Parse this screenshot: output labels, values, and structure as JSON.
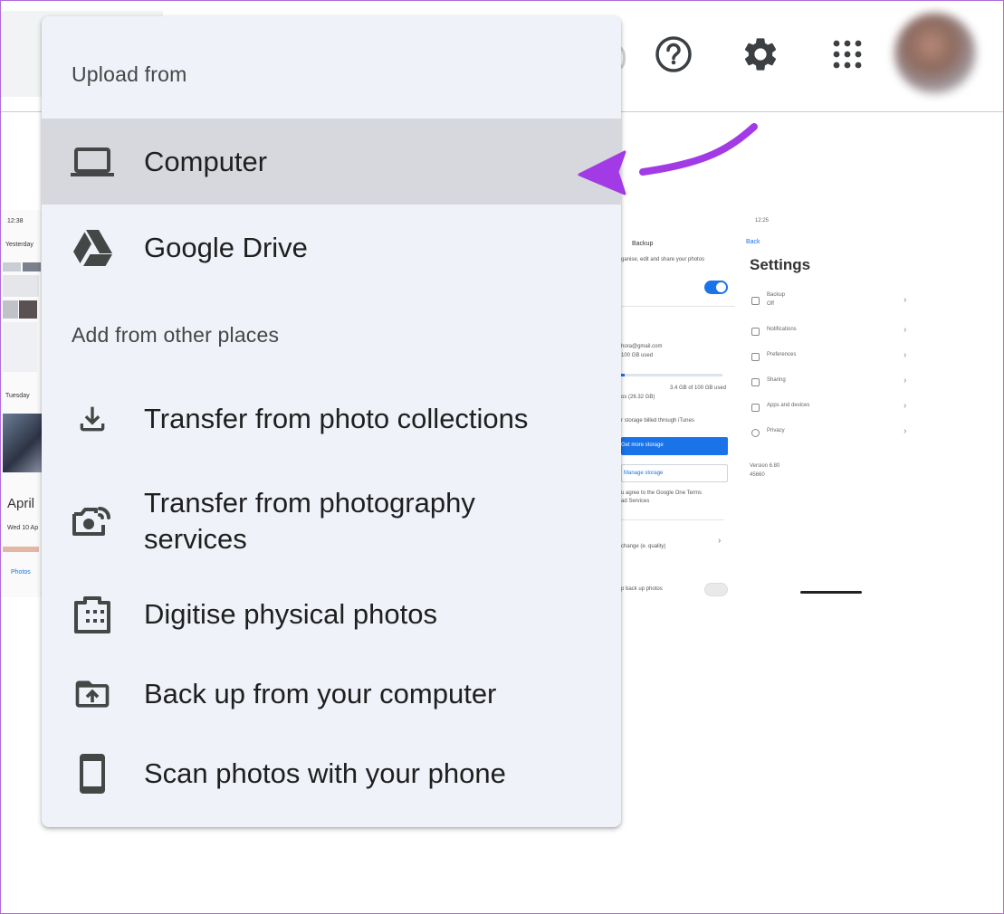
{
  "header": {
    "icons": [
      "help-icon",
      "settings-gear-icon",
      "apps-grid-icon",
      "avatar"
    ]
  },
  "upload_menu": {
    "upload_section_title": "Upload from",
    "other_section_title": "Add from other places",
    "items": [
      {
        "label": "Computer",
        "icon": "laptop-icon",
        "highlighted": true
      },
      {
        "label": "Google Drive",
        "icon": "google-drive-icon"
      },
      {
        "label": "Transfer from photo collections",
        "icon": "download-icon"
      },
      {
        "label": "Transfer from photography services",
        "label_line1": "Transfer from photography",
        "label_line2": "services",
        "icon": "camera-cast-icon"
      },
      {
        "label": "Digitise physical photos",
        "icon": "film-scanner-icon"
      },
      {
        "label": "Back up from your computer",
        "icon": "folder-upload-icon"
      },
      {
        "label": "Scan photos with your phone",
        "icon": "smartphone-icon"
      }
    ]
  },
  "annotation": {
    "color": "#a23be6",
    "points_to": "Computer"
  },
  "background_screens": {
    "left": {
      "time": "12:38",
      "yesterday": "Yesterday",
      "tuesday": "Tuesday",
      "april": "April",
      "date": "Wed 10 Ap",
      "tab": "Photos"
    },
    "backup": {
      "title": "Backup",
      "subtitle": "ganise, edit and share your photos",
      "account": "hora@gmail.com",
      "storage_used": "100 GB used",
      "storage_detail": "3.4 GB of 100 GB used",
      "storage_other": "os (26.32 GB)",
      "itunes_note": "r storage billed through iTunes",
      "buy_button": "Get more storage",
      "manage_button": "Manage storage",
      "terms": "u agree to the Google One Terms",
      "terms2": "ad Services",
      "quality": "change (e. quality)",
      "cellular": "p back up photos"
    },
    "settings": {
      "time": "12:25",
      "back": "Back",
      "title": "Settings",
      "rows": [
        "Backup",
        "Notifications",
        "Preferences",
        "Sharing",
        "Apps and devices",
        "Privacy"
      ],
      "backup_sub": "Off",
      "version": "Version 6.80",
      "build": "45660"
    }
  }
}
